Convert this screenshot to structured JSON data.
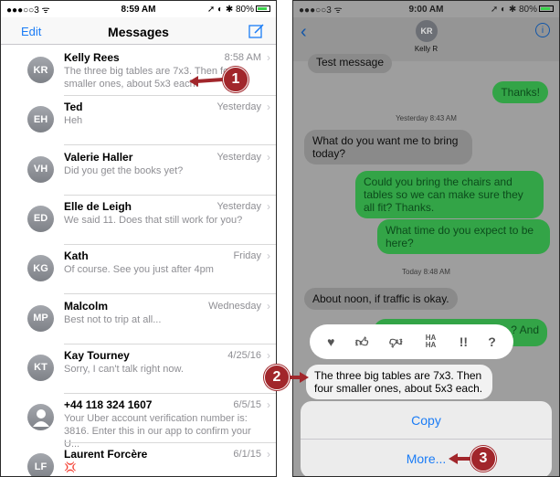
{
  "left": {
    "status": {
      "signal": "●●●○○3 ᯤ",
      "time": "8:59 AM",
      "right": "➚ ◐ ✱ 80%"
    },
    "nav": {
      "edit": "Edit",
      "title": "Messages"
    },
    "conversations": [
      {
        "initials": "KR",
        "name": "Kelly Rees",
        "time": "8:58 AM",
        "preview": "The three big tables are 7x3. Then four smaller ones, about 5x3 each."
      },
      {
        "initials": "EH",
        "name": "Ted",
        "time": "Yesterday",
        "preview": "Heh"
      },
      {
        "initials": "VH",
        "name": "Valerie Haller",
        "time": "Yesterday",
        "preview": "Did you get the books yet?"
      },
      {
        "initials": "ED",
        "name": "Elle de Leigh",
        "time": "Yesterday",
        "preview": "We said 11. Does that still work for you?"
      },
      {
        "initials": "KG",
        "name": "Kath",
        "time": "Friday",
        "preview": "Of course. See you just after 4pm"
      },
      {
        "initials": "MP",
        "name": "Malcolm",
        "time": "Wednesday",
        "preview": "Best not to trip at all..."
      },
      {
        "initials": "KT",
        "name": "Kay Tourney",
        "time": "4/25/16",
        "preview": "Sorry, I can't talk right now."
      },
      {
        "initials": "",
        "name": "+44 118 324 1607",
        "time": "6/5/15",
        "preview": "Your Uber account verification number is: 3816. Enter this in our app to confirm your U..."
      },
      {
        "initials": "LF",
        "name": "Laurent Forcère",
        "time": "6/1/15",
        "preview": "💢"
      }
    ]
  },
  "right": {
    "status": {
      "signal": "●●●○○3 ᯤ",
      "time": "9:00 AM",
      "right": "➚ ◐ ✱ 80%"
    },
    "contact": {
      "initials": "KR",
      "name": "Kelly R"
    },
    "messages": {
      "m0": "Test message",
      "m1": "Thanks!",
      "t1": "Yesterday 8:43 AM",
      "m2": "What do you want me to bring today?",
      "m3": "Could you bring the chairs and tables so we can make sure they all fit? Thanks.",
      "m4": "What time do you expect to be here?",
      "t2": "Today 8:48 AM",
      "m5": "About noon, if traffic is okay.",
      "m6": "? And",
      "m7": "The three big tables are 7x3. Then four smaller ones, about 5x3 each."
    },
    "tapback": {
      "haha": "HA HA",
      "exclaim": "!!",
      "question": "?"
    },
    "sheet": {
      "copy": "Copy",
      "more": "More..."
    }
  },
  "callouts": [
    "1",
    "2",
    "3"
  ]
}
